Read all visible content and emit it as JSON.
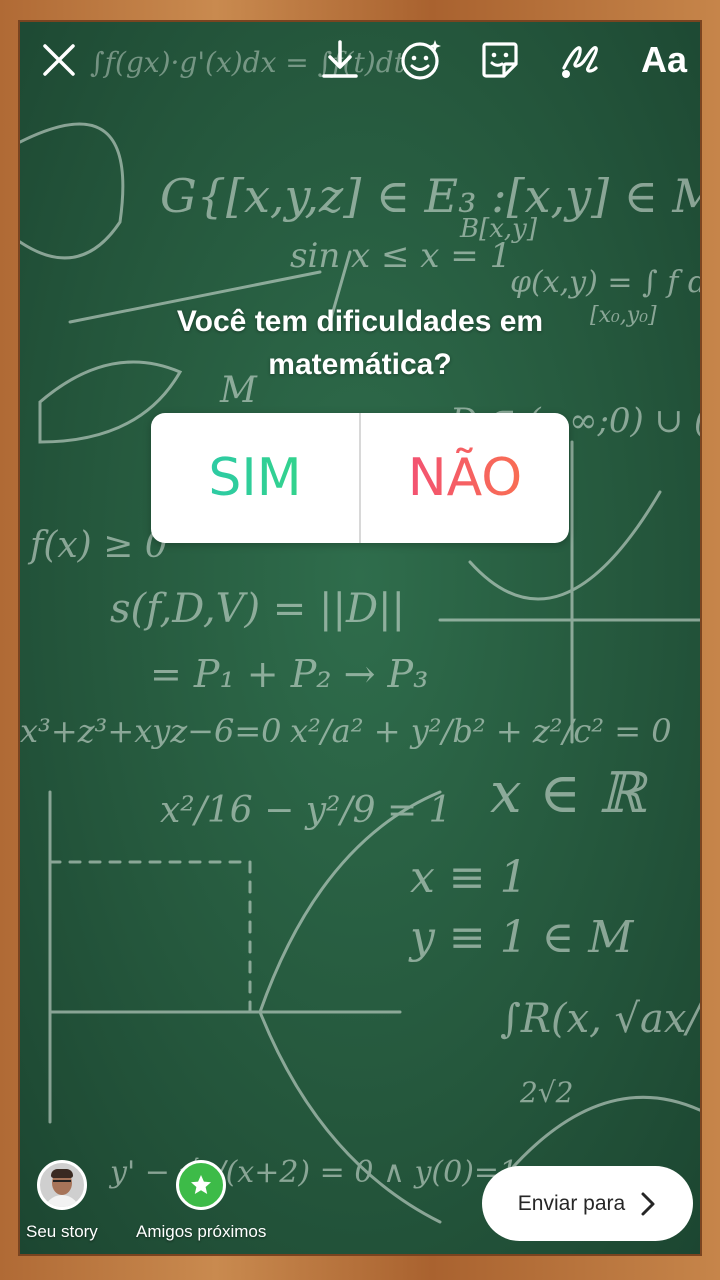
{
  "toolbar": {
    "text_tool_label": "Aa",
    "icons": [
      "close-icon",
      "download-icon",
      "effects-icon",
      "sticker-icon",
      "draw-icon"
    ]
  },
  "poll": {
    "question": "Você tem dificuldades em matemática?",
    "option_yes": "SIM",
    "option_no": "NÃO",
    "yes_color_start": "#2ac6b2",
    "yes_color_end": "#36d77e",
    "no_color_start": "#f0467e",
    "no_color_end": "#fb7a47"
  },
  "bottom_bar": {
    "your_story_label": "Seu story",
    "close_friends_label": "Amigos próximos",
    "send_label": "Enviar para",
    "close_friends_color": "#3dbb48"
  }
}
